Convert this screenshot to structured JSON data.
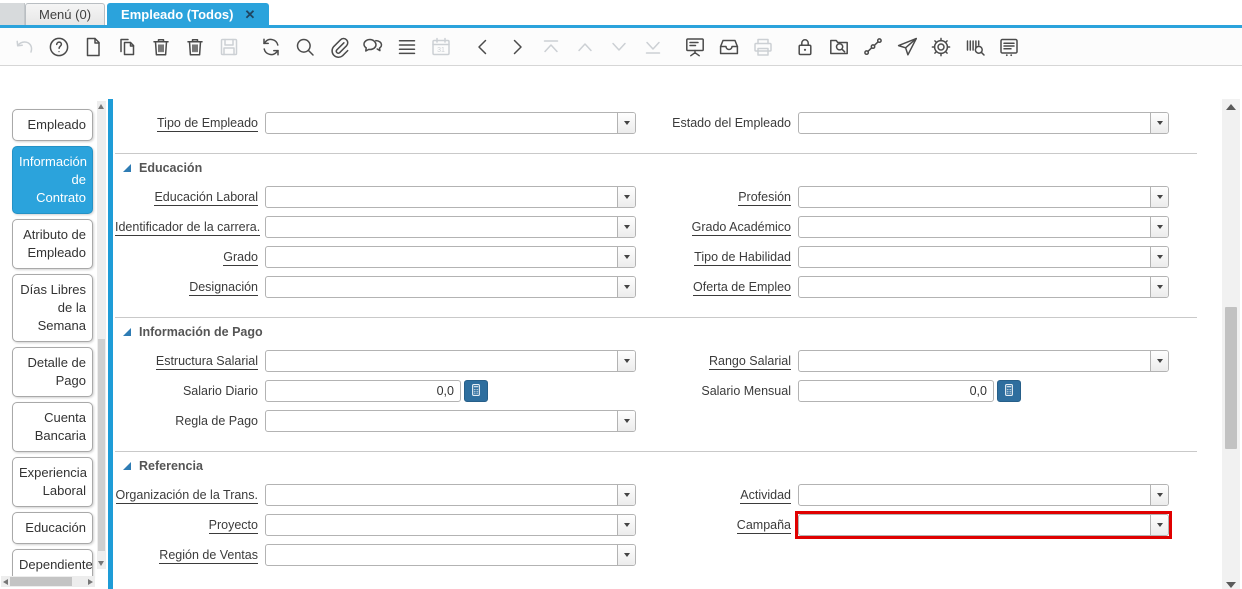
{
  "colors": {
    "accent": "#2BA3DC",
    "splitter": "#1E9CD7",
    "highlight": "#E00000",
    "calc_button": "#2E6E9E",
    "icon": "#4B4B4B"
  },
  "tabbar": {
    "close_glyph": "✕",
    "tabs": [
      {
        "label": "Menú (0)",
        "active": false,
        "closable": false
      },
      {
        "label": "Empleado (Todos)",
        "active": true,
        "closable": true
      }
    ]
  },
  "toolbar": {
    "buttons": [
      {
        "icon": "undo",
        "enabled": false
      },
      {
        "icon": "help",
        "enabled": true
      },
      {
        "icon": "new-record",
        "enabled": true
      },
      {
        "icon": "copy-record",
        "enabled": true
      },
      {
        "icon": "delete-record",
        "enabled": true
      },
      {
        "icon": "delete-selection",
        "enabled": true
      },
      {
        "icon": "save",
        "enabled": false
      },
      {
        "icon": "refresh",
        "enabled": true,
        "group_start": true
      },
      {
        "icon": "find",
        "enabled": true
      },
      {
        "icon": "attachment",
        "enabled": true
      },
      {
        "icon": "chat",
        "enabled": true
      },
      {
        "icon": "grid-toggle",
        "enabled": true
      },
      {
        "icon": "calendar",
        "enabled": false
      },
      {
        "icon": "previous-record",
        "enabled": true,
        "group_start": true
      },
      {
        "icon": "next-record",
        "enabled": true
      },
      {
        "icon": "parent-record",
        "enabled": false
      },
      {
        "icon": "up",
        "enabled": false
      },
      {
        "icon": "down",
        "enabled": false
      },
      {
        "icon": "detail-record",
        "enabled": false
      },
      {
        "icon": "report",
        "enabled": true,
        "group_start": true
      },
      {
        "icon": "archive",
        "enabled": true
      },
      {
        "icon": "print",
        "enabled": false
      },
      {
        "icon": "lock",
        "enabled": true,
        "group_start": true
      },
      {
        "icon": "zoom-across",
        "enabled": true
      },
      {
        "icon": "workflow",
        "enabled": true
      },
      {
        "icon": "send-mail",
        "enabled": true
      },
      {
        "icon": "process",
        "enabled": true
      },
      {
        "icon": "product-info",
        "enabled": true
      },
      {
        "icon": "window-customization",
        "enabled": true
      }
    ]
  },
  "sidebar": {
    "tabs": [
      {
        "label": "Empleado",
        "active": false
      },
      {
        "label": "Información de Contrato",
        "active": true
      },
      {
        "label": "Atributo de Empleado",
        "active": false
      },
      {
        "label": "Días Libres de la Semana",
        "active": false
      },
      {
        "label": "Detalle de Pago",
        "active": false
      },
      {
        "label": "Cuenta Bancaria",
        "active": false
      },
      {
        "label": "Experiencia Laboral",
        "active": false
      },
      {
        "label": "Educación",
        "active": false
      },
      {
        "label": "Dependiente",
        "active": false
      }
    ]
  },
  "form": {
    "sections": [
      {
        "rows": [
          {
            "left": {
              "label": "Tipo de Empleado",
              "underlined": true,
              "type": "combo",
              "value": ""
            },
            "right": {
              "label": "Estado del Empleado",
              "underlined": false,
              "type": "combo",
              "value": ""
            }
          }
        ]
      },
      {
        "header": "Educación",
        "rows": [
          {
            "left": {
              "label": "Educación Laboral",
              "underlined": true,
              "type": "combo",
              "value": ""
            },
            "right": {
              "label": "Profesión",
              "underlined": true,
              "type": "combo",
              "value": ""
            }
          },
          {
            "left": {
              "label": "Identificador de la carrera.",
              "underlined": true,
              "type": "combo",
              "value": ""
            },
            "right": {
              "label": "Grado Académico",
              "underlined": true,
              "type": "combo",
              "value": ""
            }
          },
          {
            "left": {
              "label": "Grado",
              "underlined": true,
              "type": "combo",
              "value": ""
            },
            "right": {
              "label": "Tipo de Habilidad",
              "underlined": true,
              "type": "combo",
              "value": ""
            }
          },
          {
            "left": {
              "label": "Designación",
              "underlined": true,
              "type": "combo",
              "value": ""
            },
            "right": {
              "label": "Oferta de Empleo",
              "underlined": true,
              "type": "combo",
              "value": ""
            }
          }
        ]
      },
      {
        "header": "Información de Pago",
        "rows": [
          {
            "left": {
              "label": "Estructura Salarial",
              "underlined": true,
              "type": "combo",
              "value": ""
            },
            "right": {
              "label": "Rango Salarial",
              "underlined": true,
              "type": "combo",
              "value": ""
            }
          },
          {
            "left": {
              "label": "Salario Diario",
              "underlined": false,
              "type": "number",
              "value": "0,0"
            },
            "right": {
              "label": "Salario Mensual",
              "underlined": false,
              "type": "number",
              "value": "0,0"
            }
          },
          {
            "left": {
              "label": "Regla de Pago",
              "underlined": false,
              "type": "combo",
              "value": ""
            }
          }
        ]
      },
      {
        "header": "Referencia",
        "rows": [
          {
            "left": {
              "label": "Organización de la Trans.",
              "underlined": true,
              "type": "combo",
              "value": ""
            },
            "right": {
              "label": "Actividad",
              "underlined": true,
              "type": "combo",
              "value": ""
            }
          },
          {
            "left": {
              "label": "Proyecto",
              "underlined": true,
              "type": "combo",
              "value": ""
            },
            "right": {
              "label": "Campaña",
              "underlined": true,
              "type": "combo",
              "value": "",
              "highlighted": true
            }
          },
          {
            "left": {
              "label": "Región de Ventas",
              "underlined": true,
              "type": "combo",
              "value": ""
            }
          }
        ]
      }
    ]
  }
}
